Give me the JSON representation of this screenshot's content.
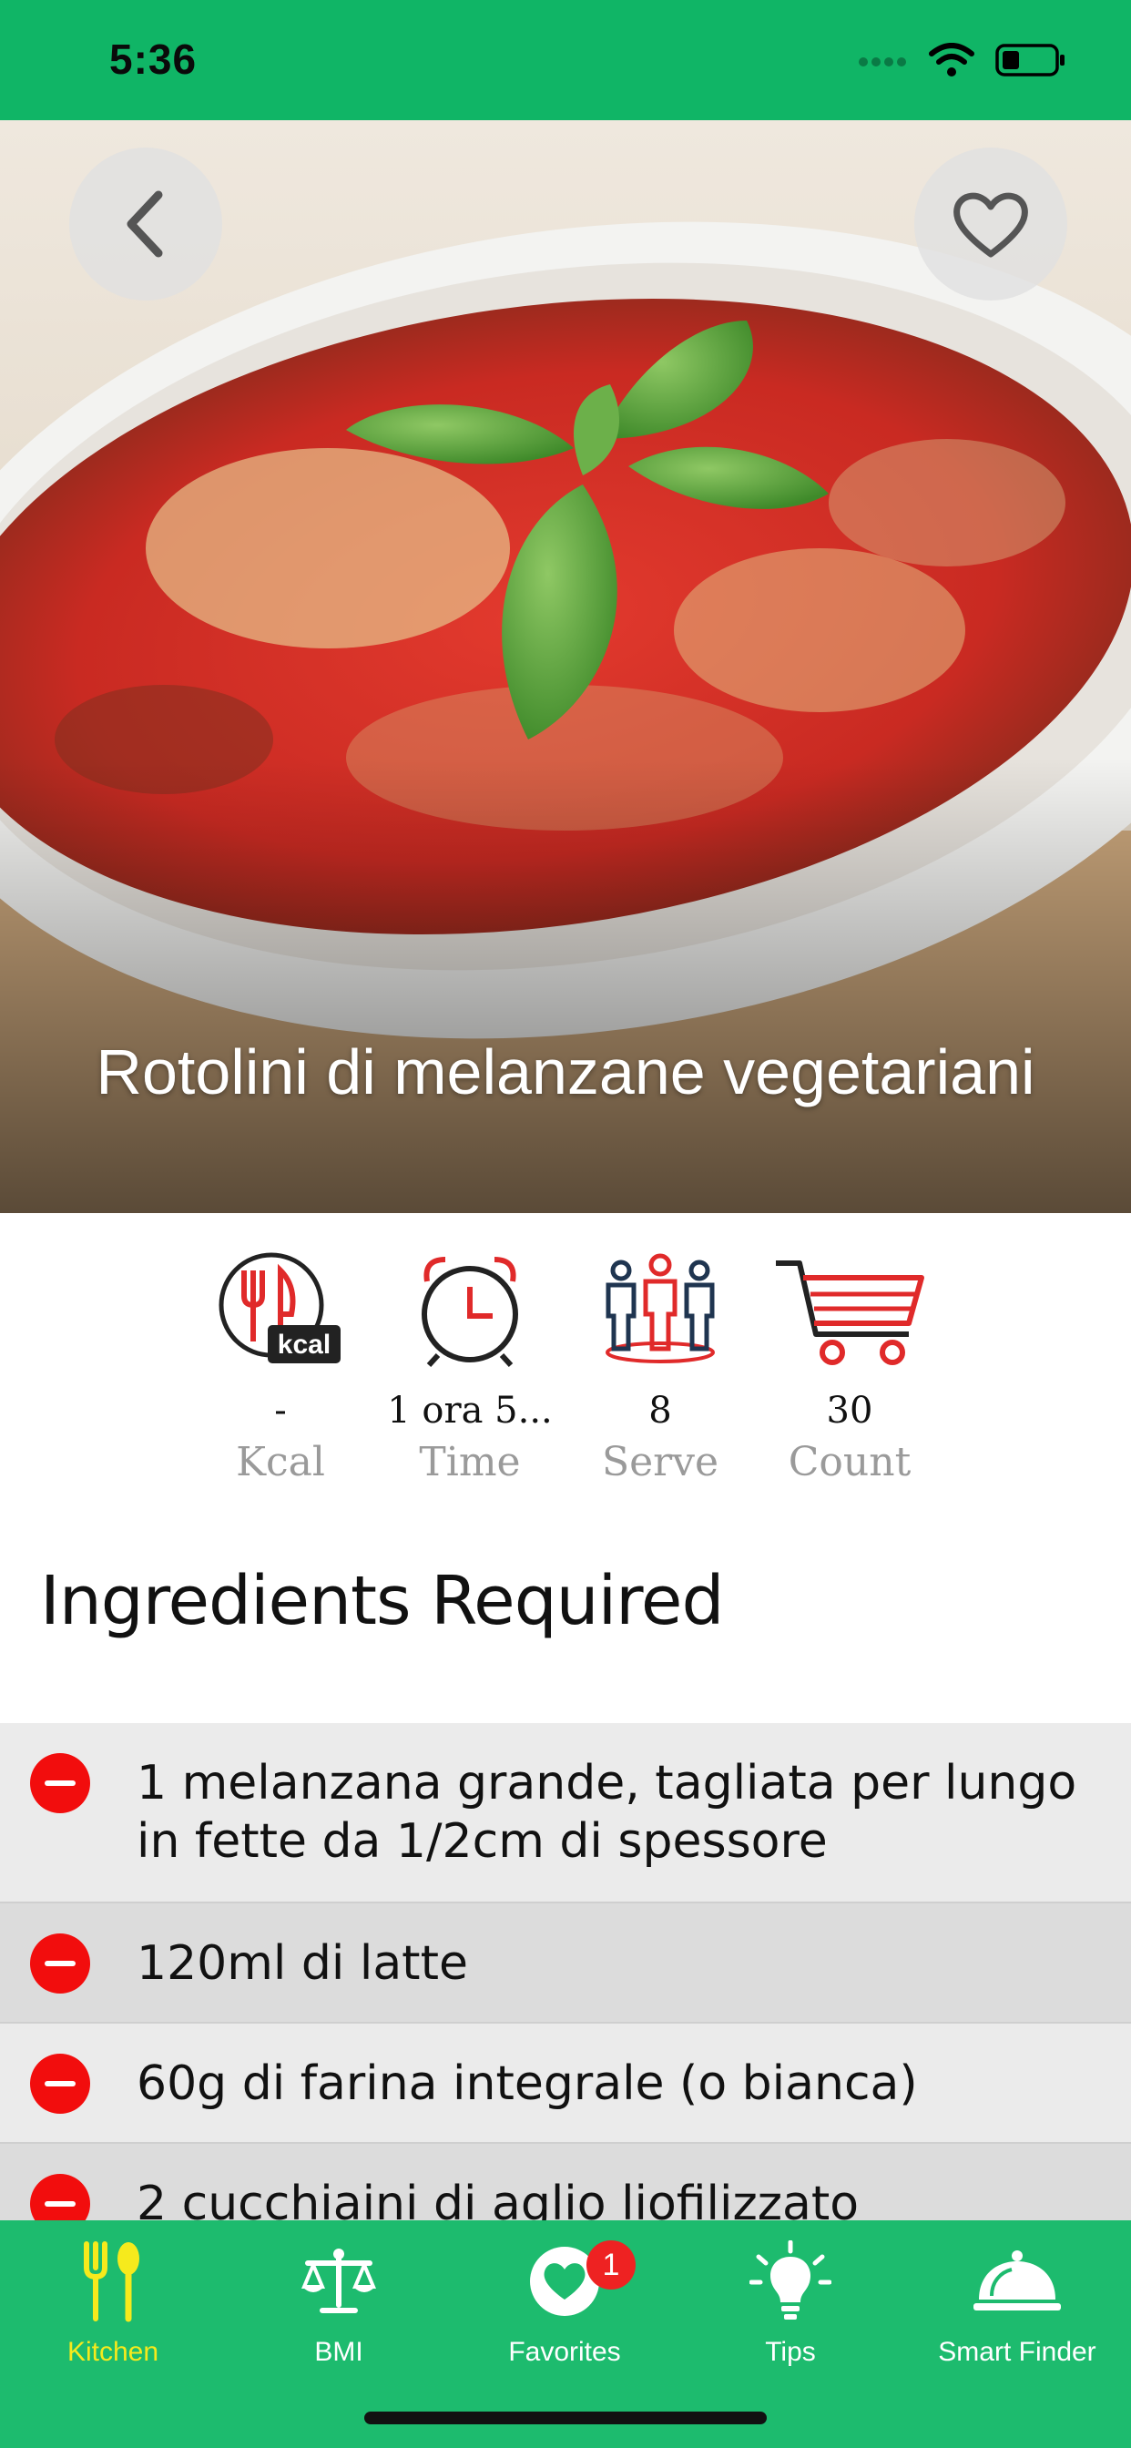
{
  "status_bar": {
    "time": "5:36"
  },
  "recipe": {
    "title": "Rotolini di melanzane vegetariani"
  },
  "stats": [
    {
      "value": "-",
      "label": "Kcal",
      "icon": "kcal-icon",
      "badge": "kcal"
    },
    {
      "value": "1 ora 5...",
      "label": "Time",
      "icon": "alarm-clock-icon"
    },
    {
      "value": "8",
      "label": "Serve",
      "icon": "people-icon"
    },
    {
      "value": "30",
      "label": "Count",
      "icon": "cart-icon"
    }
  ],
  "ingredients": {
    "heading": "Ingredients Required",
    "items": [
      "1 melanzana grande, tagliata per lungo in fette da 1/2cm di spessore",
      "120ml di latte",
      "60g di farina integrale (o bianca)",
      "2 cucchiaini di aglio liofilizzato"
    ]
  },
  "tab_bar": {
    "tabs": [
      {
        "label": "Kitchen",
        "icon": "fork-spoon-icon",
        "active": true
      },
      {
        "label": "BMI",
        "icon": "scale-icon"
      },
      {
        "label": "Favorites",
        "icon": "heart-icon",
        "badge": "1"
      },
      {
        "label": "Tips",
        "icon": "lightbulb-icon"
      },
      {
        "label": "Smart Finder",
        "icon": "cloche-icon"
      }
    ]
  },
  "colors": {
    "primary_green": "#10b566",
    "tab_green": "#1dbb6e",
    "active_tab": "#f6ea1c",
    "remove_red": "#f20d0d"
  }
}
